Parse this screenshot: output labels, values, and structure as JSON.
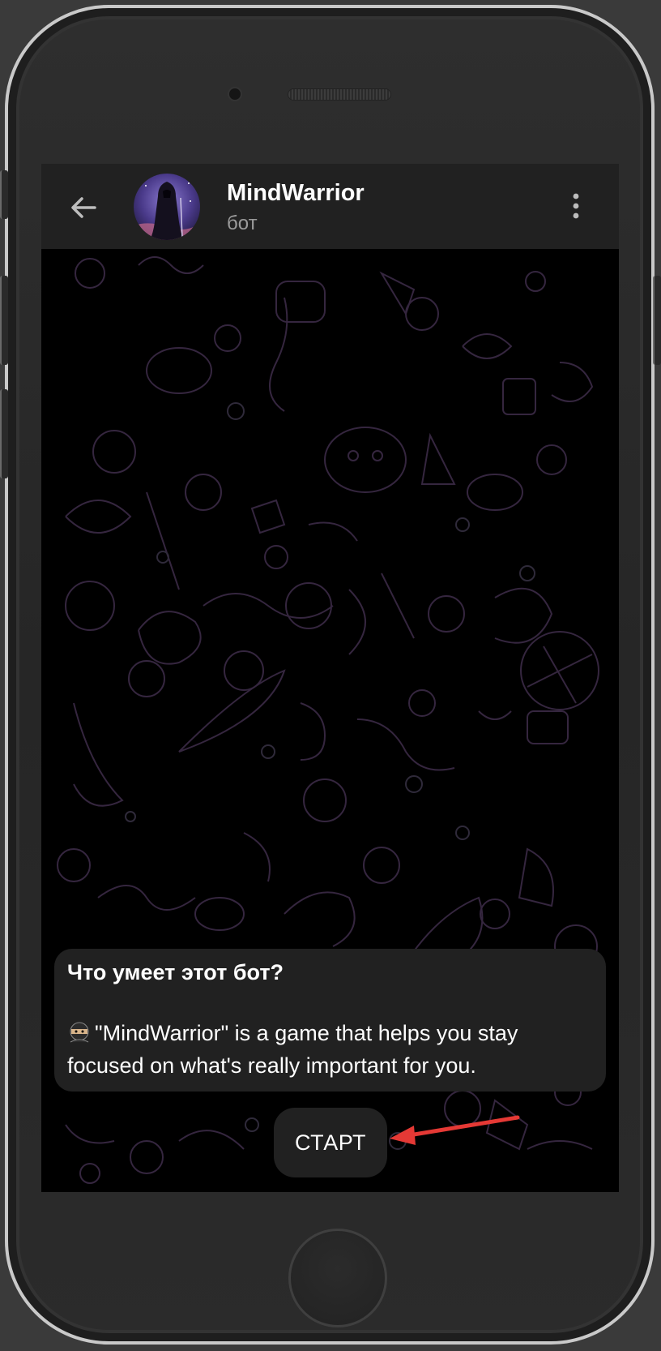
{
  "chat": {
    "bot_name": "MindWarrior",
    "bot_label": "бот",
    "avatar_icon": "hooded-warrior-avatar",
    "back_icon": "arrow-left-icon",
    "menu_icon": "more-vertical-icon"
  },
  "bot_info": {
    "heading": "Что умеет этот бот?",
    "emoji_icon": "ninja-icon",
    "description": "\"MindWarrior\" is a game that helps you stay focused on what's really important for you."
  },
  "start_button": {
    "label": "СТАРТ"
  },
  "colors": {
    "header_bg": "#212121",
    "chat_bg": "#000000",
    "bubble_bg": "#212121",
    "annotation_arrow": "#e53935",
    "pattern_stroke": "#3a2a4a"
  }
}
